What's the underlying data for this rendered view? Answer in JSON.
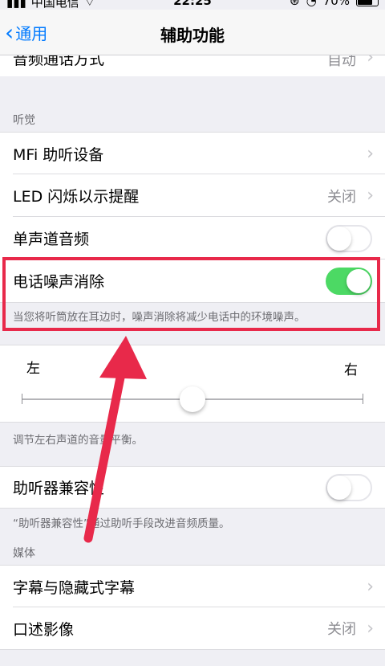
{
  "status_bar": {
    "carrier": "中国电信",
    "time": "22:25",
    "battery": "70%"
  },
  "nav": {
    "back_label": "通用",
    "title": "辅助功能"
  },
  "top_row": {
    "label": "音频通话方式",
    "value": "自动"
  },
  "hearing": {
    "header": "听觉",
    "mfi_label": "MFi 助听设备",
    "led_label": "LED 闪烁以示提醒",
    "led_value": "关闭",
    "mono_label": "单声道音频",
    "mono_on": false,
    "noise_label": "电话噪声消除",
    "noise_on": true,
    "noise_footer": "当您将听筒放在耳边时，噪声消除将减少电话中的环境噪声。"
  },
  "balance": {
    "left_label": "左",
    "right_label": "右",
    "position": 0.5,
    "footer": "调节左右声道的音量平衡。"
  },
  "hac": {
    "label": "助听器兼容性",
    "on": false,
    "footer": "“助听器兼容性”通过助听手段改进音频质量。"
  },
  "media": {
    "header": "媒体",
    "subtitles_label": "字幕与隐藏式字幕",
    "audio_desc_label": "口述影像",
    "audio_desc_value": "关闭"
  },
  "colors": {
    "accent": "#007aff",
    "toggle_on": "#4cd964",
    "highlight": "#e8294a"
  }
}
